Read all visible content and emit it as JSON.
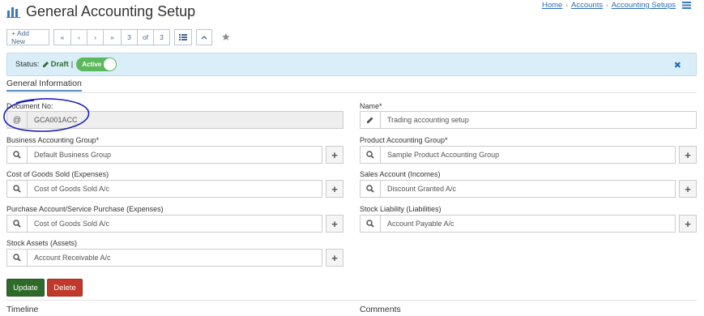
{
  "header": {
    "title": "General Accounting Setup",
    "title_icon": "bar-chart-icon"
  },
  "breadcrumb": [
    {
      "label": "Home"
    },
    {
      "label": "Accounts"
    },
    {
      "label": "Accounting Setups"
    }
  ],
  "toolbar": {
    "add_new_label": "+ Add New",
    "first_label": "«",
    "prev_label": "‹",
    "next_label": "›",
    "last_label": "»",
    "current_page": "3",
    "of_label": "of",
    "total_pages": "3",
    "list_icon": "list-icon",
    "up_icon": "caret-up-icon",
    "star_icon": "star-icon"
  },
  "status": {
    "label": "Status:",
    "draft": "Draft",
    "separator": "|",
    "toggle_label": "Active",
    "toggle_on": true,
    "close_icon": "close-icon"
  },
  "section": {
    "tab": "General Information"
  },
  "form": {
    "document_no": {
      "label": "Document No:",
      "prefix": "@",
      "value": "GCA001ACC"
    },
    "name": {
      "label": "Name*",
      "value": "Trading accounting setup"
    },
    "business_group": {
      "label": "Business Accounting Group*",
      "value": "Default Business Group"
    },
    "product_group": {
      "label": "Product Accounting Group*",
      "value": "Sample Product Accounting Group"
    },
    "cogs": {
      "label": "Cost of Goods Sold (Expenses)",
      "value": "Cost of Goods Sold A/c"
    },
    "sales_account": {
      "label": "Sales Account (Incomes)",
      "value": "Discount Granted A/c"
    },
    "purchase_account": {
      "label": "Purchase Account/Service Purchase (Expenses)",
      "value": "Cost of Goods Sold A/c"
    },
    "stock_liability": {
      "label": "Stock Liability (Liabilities)",
      "value": "Account Payable A/c"
    },
    "stock_assets": {
      "label": "Stock Assets (Assets)",
      "value": "Account Receivable A/c"
    }
  },
  "actions": {
    "update_label": "Update",
    "delete_label": "Delete"
  },
  "footer": {
    "timeline_title": "Timeline",
    "comments_title": "Comments"
  },
  "colors": {
    "accent": "#2a6db5",
    "status_bg": "#d9eef8",
    "toggle_on": "#5cb85c",
    "update": "#2e6b2a",
    "delete": "#c0392b",
    "annotation": "#1a22b8"
  }
}
